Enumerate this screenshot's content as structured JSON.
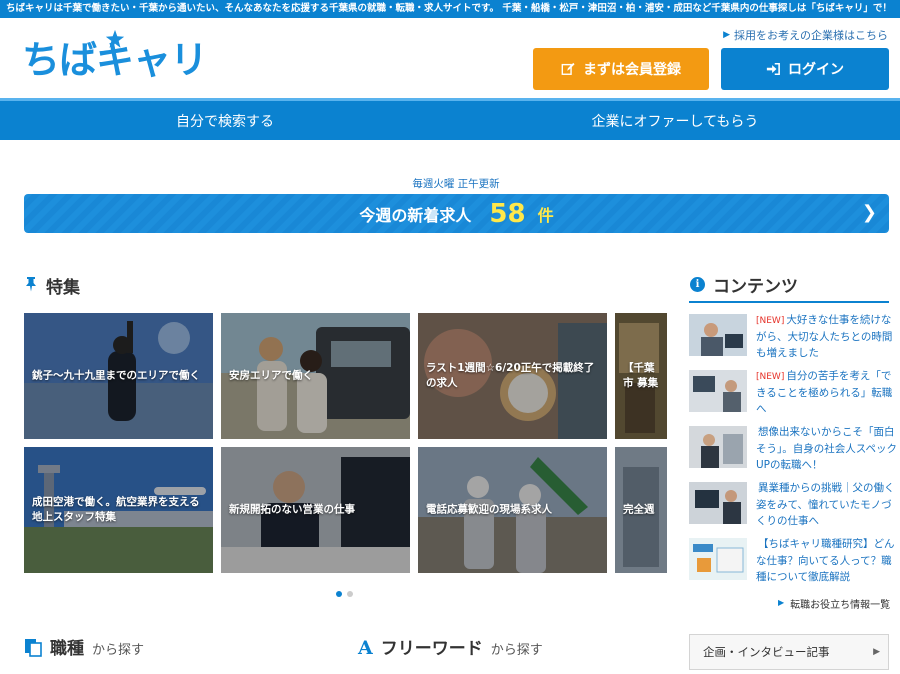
{
  "topbar": {
    "text": "ちばキャリは千葉で働きたい・千葉から通いたい、そんなあなたを応援する千葉県の就職・転職・求人サイトです。 千葉・船橋・松戸・津田沼・柏・浦安・成田など千葉県内の仕事探しは「ちばキャリ」で！"
  },
  "header": {
    "logo_text": "ちばキャリ",
    "corp_link": "採用をお考えの企業様はこちら",
    "register_label": "まずは会員登録",
    "login_label": "ログイン"
  },
  "nav": [
    {
      "label": "自分で検索する"
    },
    {
      "label": "企業にオファーしてもらう"
    }
  ],
  "new_jobs": {
    "update_note": "毎週火曜 正午更新",
    "label": "今週の新着求人",
    "count": "58",
    "unit": "件"
  },
  "features": {
    "title": "特集",
    "items": [
      {
        "caption": "銚子～九十九里までのエリアで働く"
      },
      {
        "caption": "安房エリアで働く"
      },
      {
        "caption": "ラスト1週間☆6/20正午で掲載終了の求人"
      },
      {
        "caption": "【千葉市 募集"
      },
      {
        "caption": "成田空港で働く。航空業界を支える地上スタッフ特集"
      },
      {
        "caption": "新規開拓のない営業の仕事"
      },
      {
        "caption": "電話応募歓迎の現場系求人"
      },
      {
        "caption": "完全週"
      }
    ]
  },
  "contents": {
    "title": "コンテンツ",
    "items": [
      {
        "badge": "[NEW]",
        "text": "大好きな仕事を続けながら、大切な人たちとの時間も増えました"
      },
      {
        "badge": "[NEW]",
        "text": "自分の苦手を考え「できることを極められる」転職へ"
      },
      {
        "badge": "",
        "text": "想像出来ないからこそ「面白そう」。自身の社会人スペックUPの転職へ！"
      },
      {
        "badge": "",
        "text": "異業種からの挑戦｜父の働く姿をみて、憧れていたモノづくりの仕事へ"
      },
      {
        "badge": "",
        "text": "【ちばキャリ職種研究】どんな仕事？向いてる人って？職種について徹底解説"
      }
    ],
    "more_link": "転職お役立ち情報一覧"
  },
  "search_sections": {
    "occupation_big": "職種",
    "occupation_small": "から探す",
    "freeword_big": "フリーワード",
    "freeword_small": "から探す"
  },
  "side_box": {
    "label": "企画・インタビュー記事"
  },
  "colors": {
    "brand": "#0b82d0",
    "register": "#f39a12",
    "accent_yellow": "#ffe84a",
    "new_badge": "#e6332a"
  },
  "icons": [
    "star-icon",
    "chevron-right-icon",
    "pencil-icon",
    "login-icon",
    "pin-icon",
    "info-icon",
    "document-icon",
    "font-a-icon"
  ]
}
